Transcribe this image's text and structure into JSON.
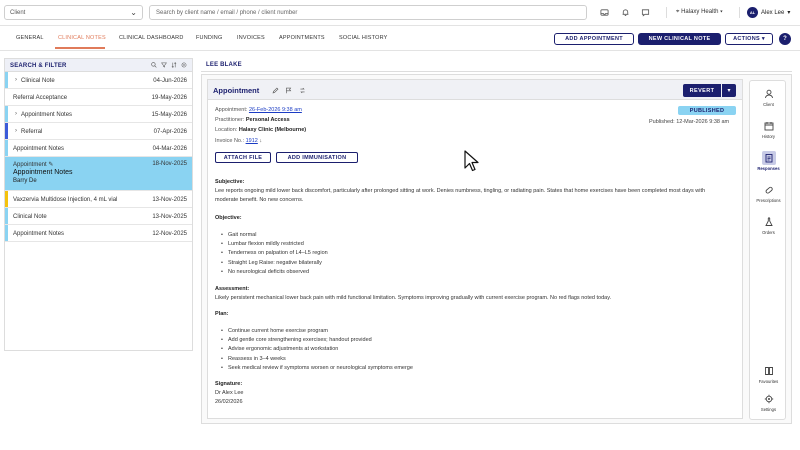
{
  "topbar": {
    "client_placeholder": "Client",
    "search_placeholder": "Search by client name / email / phone / client number",
    "clinic": "Halaxy Health",
    "user_initials": "AL",
    "user_name": "Alex Lee"
  },
  "tabs": [
    {
      "label": "GENERAL"
    },
    {
      "label": "CLINICAL NOTES",
      "active": true
    },
    {
      "label": "CLINICAL DASHBOARD"
    },
    {
      "label": "FUNDING"
    },
    {
      "label": "INVOICES"
    },
    {
      "label": "APPOINTMENTS"
    },
    {
      "label": "SOCIAL HISTORY"
    }
  ],
  "actions": {
    "add_appointment": "ADD APPOINTMENT",
    "new_clinical_note": "NEW CLINICAL NOTE",
    "actions": "ACTIONS",
    "help": "?"
  },
  "left": {
    "title": "SEARCH & FILTER",
    "notes": [
      {
        "label": "Clinical Note",
        "date": "04-Jun-2026",
        "expandable": true
      },
      {
        "label": "Referral Acceptance",
        "date": "19-May-2026"
      },
      {
        "label": "Appointment Notes",
        "date": "15-May-2026",
        "expandable": true
      },
      {
        "label": "Referral",
        "date": "07-Apr-2026",
        "expandable": true
      },
      {
        "label": "Appointment Notes",
        "date": "04-Mar-2026"
      },
      {
        "label": "Appointment",
        "title": "Appointment Notes",
        "practitioner": "Barry De",
        "date": "18-Nov-2025",
        "selected": true
      },
      {
        "label": "Vaxzervia Multidose Injection, 4 mL vial",
        "date": "13-Nov-2025"
      },
      {
        "label": "Clinical Note",
        "date": "13-Nov-2025"
      },
      {
        "label": "Appointment Notes",
        "date": "12-Nov-2025"
      }
    ],
    "colors": {
      "blue": "#3b5bd9",
      "navy": "#1b1f6e",
      "yellow": "#f4c20d",
      "light": "#8ad3f2"
    }
  },
  "patient": {
    "name": "LEE BLAKE"
  },
  "note": {
    "title": "Appointment",
    "revert": "REVERT",
    "status": "PUBLISHED",
    "published": "Published: 12-Mar-2026 9:38 am",
    "appointment_label": "Appointment:",
    "appointment_value": "26-Feb-2026 9:38 am",
    "practitioner_label": "Practitioner:",
    "practitioner_value": "Personal Access",
    "location_label": "Location:",
    "location_value": "Halaxy Clinic (Melbourne)",
    "invoice_label": "Invoice No.:",
    "invoice_value": "1912",
    "attach_file": "ATTACH FILE",
    "add_immunisation": "ADD IMMUNISATION",
    "subjective_h": "Subjective:",
    "subjective": "Lee reports ongoing mild lower back discomfort, particularly after prolonged sitting at work. Denies numbness, tingling, or radiating pain. States that home exercises have been completed most days with moderate benefit. No new concerns.",
    "objective_h": "Objective:",
    "objective": [
      "Gait normal",
      "Lumbar flexion mildly restricted",
      "Tenderness on palpation of L4–L5 region",
      "Straight Leg Raise: negative bilaterally",
      "No neurological deficits observed"
    ],
    "assessment_h": "Assessment:",
    "assessment": "Likely persistent mechanical lower back pain with mild functional limitation. Symptoms improving gradually with current exercise program. No red flags noted today.",
    "plan_h": "Plan:",
    "plan": [
      "Continue current home exercise program",
      "Add gentle core strengthening exercises; handout provided",
      "Advise ergonomic adjustments at workstation",
      "Reassess in 3–4 weeks",
      "Seek medical review if symptoms worsen or neurological symptoms emerge"
    ],
    "signature_h": "Signature:",
    "signature_name": "Dr Alex Lee",
    "signature_date": "26/02/2026"
  },
  "rail": [
    {
      "label": "Client",
      "icon": "person-icon"
    },
    {
      "label": "History",
      "icon": "calendar-icon"
    },
    {
      "label": "Responses",
      "icon": "clipboard-icon",
      "active": true
    },
    {
      "label": "Prescriptions",
      "icon": "pill-icon"
    },
    {
      "label": "Orders",
      "icon": "flask-icon"
    },
    {
      "label": "Favourites",
      "icon": "book-icon"
    },
    {
      "label": "Settings",
      "icon": "gear-icon"
    }
  ]
}
